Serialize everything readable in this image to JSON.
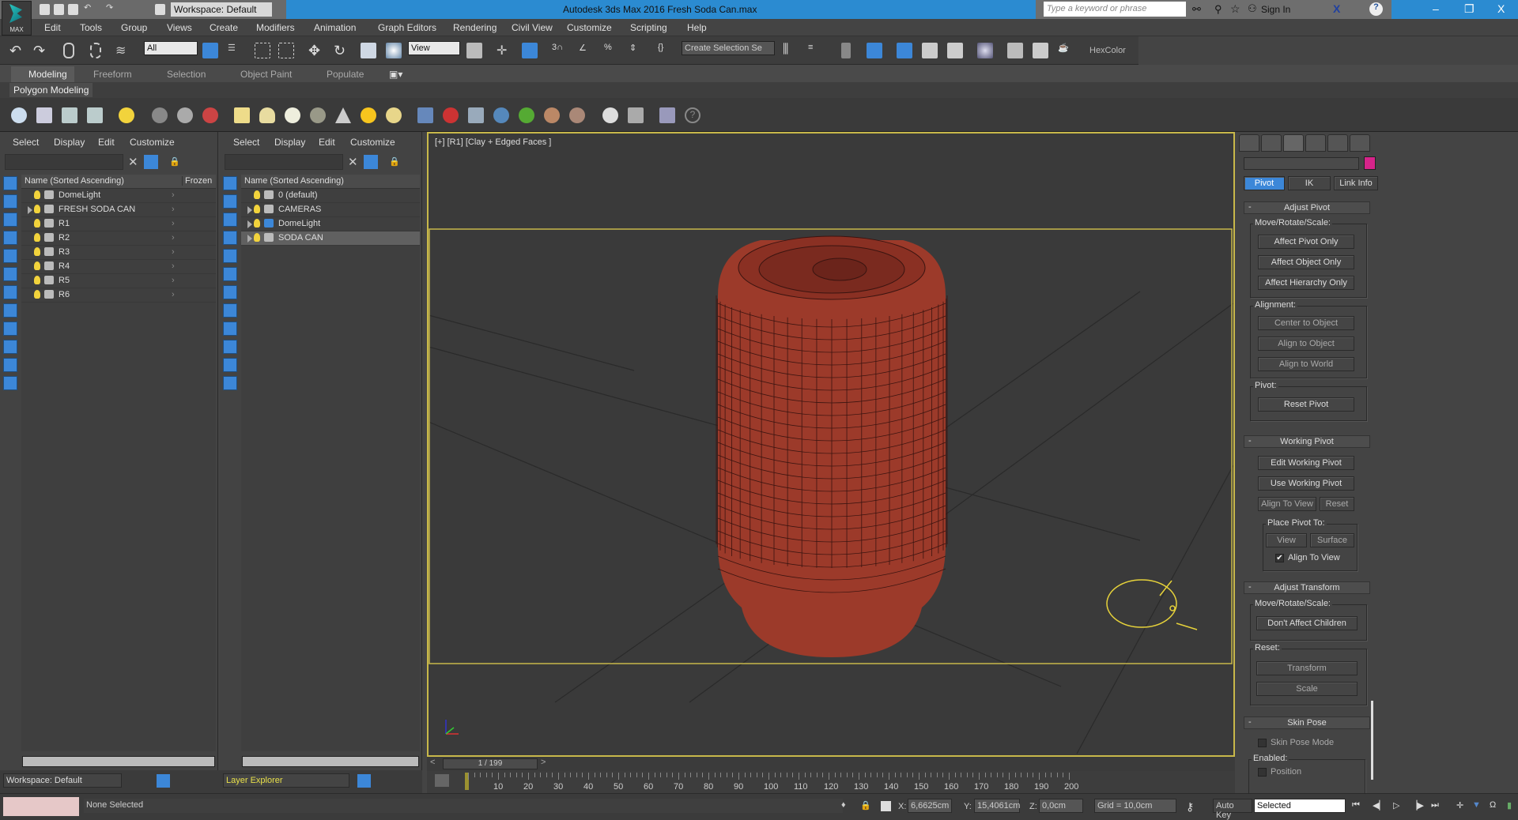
{
  "titlebar": {
    "workspace": "Workspace: Default",
    "app_title": "Autodesk 3ds Max 2016    Fresh Soda Can.max",
    "search_placeholder": "Type a keyword or phrase",
    "sign_in": "Sign In",
    "logo_text": "MAX"
  },
  "menu": [
    "Edit",
    "Tools",
    "Group",
    "Views",
    "Create",
    "Modifiers",
    "Animation",
    "Graph Editors",
    "Rendering",
    "Civil View",
    "Customize",
    "Scripting",
    "Help"
  ],
  "toolbar": {
    "selection_filter": "All",
    "ref_coord": "View",
    "named_selection": "Create Selection Se",
    "hexcolor": "HexColor"
  },
  "ribbon": {
    "tabs": [
      "Modeling",
      "Freeform",
      "Selection",
      "Object Paint",
      "Populate"
    ],
    "active": "Modeling",
    "panel": "Polygon Modeling"
  },
  "scene_explorer": {
    "menu": [
      "Select",
      "Display",
      "Edit",
      "Customize"
    ],
    "col_name": "Name (Sorted Ascending)",
    "col_frozen": "Frozen",
    "items": [
      "DomeLight",
      "FRESH SODA CAN",
      "R1",
      "R2",
      "R3",
      "R4",
      "R5",
      "R6"
    ],
    "footer": "Workspace: Default"
  },
  "layer_explorer": {
    "menu": [
      "Select",
      "Display",
      "Edit",
      "Customize"
    ],
    "col_name": "Name (Sorted Ascending)",
    "items": [
      "0 (default)",
      "CAMERAS",
      "DomeLight",
      "SODA CAN"
    ],
    "selected": "SODA CAN",
    "footer": "Layer Explorer"
  },
  "viewport": {
    "label": "[+] [R1] [Clay + Edged Faces ]",
    "frame": "1 / 199"
  },
  "timeline": {
    "ticks": [
      "10",
      "20",
      "30",
      "40",
      "50",
      "60",
      "70",
      "80",
      "90",
      "100",
      "110",
      "120",
      "130",
      "140",
      "150",
      "160",
      "170",
      "180",
      "190",
      "200"
    ]
  },
  "command_panel": {
    "tabs": [
      "Pivot",
      "IK",
      "Link Info"
    ],
    "active_tab": "Pivot",
    "color_swatch": "#d6248a",
    "adjust_pivot": {
      "title": "Adjust Pivot",
      "mrs": "Move/Rotate/Scale:",
      "b1": "Affect Pivot Only",
      "b2": "Affect Object Only",
      "b3": "Affect Hierarchy Only",
      "alignment": "Alignment:",
      "b4": "Center to Object",
      "b5": "Align to Object",
      "b6": "Align to World",
      "pivot": "Pivot:",
      "b7": "Reset Pivot"
    },
    "working_pivot": {
      "title": "Working Pivot",
      "b1": "Edit Working Pivot",
      "b2": "Use Working Pivot",
      "b3": "Align To View",
      "b4": "Reset",
      "place": "Place Pivot To:",
      "b5": "View",
      "b6": "Surface",
      "chk": "Align To View"
    },
    "adjust_transform": {
      "title": "Adjust Transform",
      "mrs": "Move/Rotate/Scale:",
      "b1": "Don't Affect Children",
      "reset": "Reset:",
      "b2": "Transform",
      "b3": "Scale"
    },
    "skin_pose": {
      "title": "Skin Pose",
      "mode": "Skin Pose Mode",
      "enabled": "Enabled:",
      "position": "Position"
    }
  },
  "status": {
    "selection": "None Selected",
    "x_label": "X:",
    "x": "6,6625cm",
    "y_label": "Y:",
    "y": "15,4061cm",
    "z_label": "Z:",
    "z": "0,0cm",
    "grid": "Grid = 10,0cm",
    "autokey": "Auto Key",
    "key_mode": "Selected"
  }
}
